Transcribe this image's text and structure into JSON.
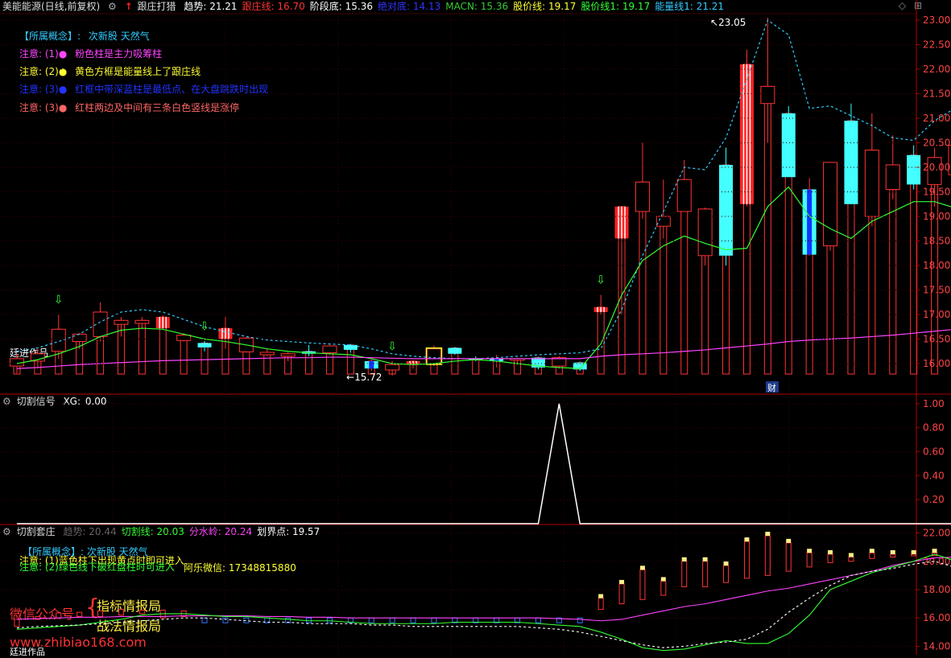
{
  "header": {
    "stock": "美能能源(日线,前复权)",
    "indicator": "跟庄打猎",
    "values": [
      {
        "label": "趋势:",
        "value": "21.21",
        "color": "#ffffff"
      },
      {
        "label": "跟庄线:",
        "value": "16.70",
        "color": "#ff3333"
      },
      {
        "label": "阶段底:",
        "value": "15.36",
        "color": "#ffffff"
      },
      {
        "label": "绝对底:",
        "value": "14.13",
        "color": "#3333ff"
      },
      {
        "label": "MACN:",
        "value": "15.36",
        "color": "#33cc33"
      },
      {
        "label": "股价线:",
        "value": "19.17",
        "color": "#ffff33"
      },
      {
        "label": "股价线1:",
        "value": "19.17",
        "color": "#33ff33"
      },
      {
        "label": "能量线1:",
        "value": "21.21",
        "color": "#33ccff"
      }
    ]
  },
  "notes": {
    "concept_label": "【所属概念】:",
    "concept_value": "次新股 天然气",
    "n1_label": "注意: (1)●",
    "n1_text": "粉色柱是主力吸筹柱",
    "n2_label": "注意: (2)●",
    "n2_text": "黄色方框是能量线上了跟庄线",
    "n3_label": "注意: (3)●",
    "n3_text": "红框中带深蓝柱是最低点、在大盘跳跌时出现",
    "n4_label": "注意: (3)●",
    "n4_text": "红柱两边及中间有三条白色竖线是涨停",
    "author": "廷进作品"
  },
  "panel2": {
    "title": "切割信号",
    "xg_label": "XG:",
    "xg_value": "0.00"
  },
  "panel3": {
    "title": "切割套庄",
    "values": [
      {
        "label": "趋势:",
        "value": "20.44",
        "color": "#666666"
      },
      {
        "label": "切割线:",
        "value": "20.03",
        "color": "#33ff33"
      },
      {
        "label": "分水岭:",
        "value": "20.24",
        "color": "#ff44ff"
      },
      {
        "label": "划界点:",
        "value": "19.57",
        "color": "#ffffff"
      }
    ],
    "concept": "【所属概念】: 次新股 天然气",
    "note1": "注意: (1)蓝色柱下出现黄点时即可进入",
    "note2": "注意: (2)绿色线下破红盘柱时可进入",
    "wechat": "阿乐微信: 17348815880",
    "promo1": "微信公众号",
    "promo2": "指标情报局",
    "promo3": "战法情报局",
    "url": "www.zhibiao168.com",
    "author": "廷进作品"
  },
  "annotations": {
    "high": "23.05",
    "low": "15.72",
    "fin": "财"
  },
  "chart_data": [
    {
      "type": "candlestick",
      "y_ticks": [
        "23.00",
        "22.50",
        "22.00",
        "21.50",
        "21.00",
        "20.50",
        "20.00",
        "19.50",
        "19.00",
        "18.50",
        "18.00",
        "17.50",
        "17.00",
        "16.50",
        "16.00"
      ],
      "ylim": [
        15.58,
        23.33
      ],
      "candles": [
        [
          15.95,
          16.2,
          15.8,
          16.1
        ],
        [
          16.05,
          16.3,
          15.9,
          16.2
        ],
        [
          16.25,
          17.0,
          16.1,
          16.7
        ],
        [
          16.45,
          16.62,
          16.3,
          16.6
        ],
        [
          16.55,
          17.25,
          16.45,
          17.05
        ],
        [
          16.8,
          16.95,
          16.55,
          16.88
        ],
        [
          16.88,
          16.95,
          16.7,
          16.82
        ],
        [
          16.95,
          16.98,
          16.7,
          16.72
        ],
        [
          16.58,
          16.62,
          16.45,
          16.47
        ],
        [
          16.42,
          16.46,
          16.25,
          16.33
        ],
        [
          16.5,
          16.95,
          16.3,
          16.72
        ],
        [
          16.52,
          16.54,
          16.22,
          16.24
        ],
        [
          16.23,
          16.29,
          16.15,
          16.18
        ],
        [
          16.2,
          16.23,
          16.05,
          16.15
        ],
        [
          16.2,
          16.38,
          16.15,
          16.25
        ],
        [
          16.36,
          16.38,
          16.18,
          16.22
        ],
        [
          16.38,
          16.4,
          16.22,
          16.28
        ],
        [
          16.05,
          16.1,
          15.85,
          15.9
        ],
        [
          15.87,
          16.05,
          15.76,
          15.98
        ],
        [
          15.98,
          16.07,
          15.9,
          16.05
        ],
        [
          16.0,
          16.37,
          15.95,
          16.3
        ],
        [
          16.32,
          16.34,
          16.18,
          16.2
        ],
        [
          16.1,
          16.15,
          16.05,
          16.1
        ],
        [
          16.1,
          16.18,
          15.92,
          16.05
        ],
        [
          16.1,
          16.12,
          15.98,
          16.08
        ],
        [
          16.12,
          16.14,
          15.88,
          15.92
        ],
        [
          15.95,
          16.15,
          15.9,
          16.12
        ],
        [
          16.02,
          16.04,
          15.85,
          15.88
        ],
        [
          17.15,
          17.4,
          17.0,
          17.05
        ],
        [
          18.55,
          19.2,
          17.0,
          19.2
        ],
        [
          19.1,
          20.5,
          18.95,
          19.7
        ],
        [
          18.8,
          19.75,
          18.55,
          19.0
        ],
        [
          19.75,
          20.15,
          19.1,
          19.1
        ],
        [
          19.15,
          19.18,
          18.0,
          18.2
        ],
        [
          18.2,
          20.4,
          18.0,
          20.05
        ],
        [
          19.25,
          22.4,
          19.2,
          22.1
        ],
        [
          21.3,
          23.05,
          20.5,
          21.65
        ],
        [
          21.1,
          21.25,
          19.85,
          19.8
        ],
        [
          19.55,
          19.78,
          18.2,
          18.22
        ],
        [
          18.4,
          20.1,
          18.3,
          20.1
        ],
        [
          20.95,
          21.3,
          19.25,
          19.25
        ],
        [
          19.0,
          21.1,
          18.8,
          20.35
        ],
        [
          19.55,
          20.65,
          19.35,
          20.05
        ],
        [
          20.25,
          20.45,
          19.55,
          19.65
        ],
        [
          19.65,
          20.4,
          19.2,
          20.2
        ],
        [
          19.85,
          20.6,
          16.9,
          20.45
        ]
      ],
      "candle_styles": {
        "hollow_red": [
          0,
          1,
          2,
          3,
          4,
          5,
          6,
          8,
          11,
          12,
          13,
          15,
          18,
          20,
          24,
          26,
          30,
          31,
          32,
          33,
          36,
          39,
          41,
          42,
          44,
          45
        ],
        "cyan": [
          9,
          14,
          16,
          21,
          22,
          25,
          27,
          34,
          37,
          40,
          43
        ],
        "blue_stripe": [
          17,
          23,
          38
        ],
        "red_white": [
          7,
          10,
          19,
          28,
          29,
          35
        ],
        "yellow_box": [
          20
        ]
      },
      "series": [
        {
          "name": "能量线1",
          "values": [
            16.25,
            16.32,
            16.45,
            16.6,
            16.85,
            17.05,
            17.1,
            17.05,
            16.9,
            16.75,
            16.65,
            16.55,
            16.48,
            16.45,
            16.42,
            16.4,
            16.38,
            16.3,
            16.2,
            16.15,
            16.12,
            16.1,
            16.1,
            16.12,
            16.15,
            16.18,
            16.2,
            16.22,
            16.3,
            17.1,
            18.2,
            19.1,
            20.0,
            19.95,
            20.6,
            21.8,
            23.0,
            22.7,
            21.2,
            21.25,
            21.05,
            20.85,
            20.6,
            20.55,
            20.95,
            21.21
          ]
        },
        {
          "name": "股价线1",
          "values": [
            16.0,
            16.08,
            16.2,
            16.35,
            16.55,
            16.68,
            16.72,
            16.7,
            16.6,
            16.5,
            16.45,
            16.38,
            16.3,
            16.25,
            16.22,
            16.2,
            16.18,
            16.1,
            16.0,
            15.98,
            16.0,
            16.05,
            16.08,
            16.05,
            16.0,
            15.95,
            15.92,
            15.9,
            16.4,
            17.4,
            18.1,
            18.4,
            18.6,
            18.45,
            18.32,
            18.35,
            19.2,
            19.6,
            19.0,
            18.75,
            18.55,
            18.9,
            19.1,
            19.3,
            19.3,
            19.17
          ]
        },
        {
          "name": "跟庄线",
          "values": [
            15.9,
            15.92,
            15.95,
            15.98,
            16.0,
            16.02,
            16.04,
            16.06,
            16.07,
            16.08,
            16.09,
            16.1,
            16.11,
            16.12,
            16.12,
            16.13,
            16.13,
            16.12,
            16.11,
            16.1,
            16.1,
            16.1,
            16.1,
            16.1,
            16.1,
            16.1,
            16.1,
            16.1,
            16.15,
            16.18,
            16.2,
            16.22,
            16.25,
            16.28,
            16.32,
            16.36,
            16.4,
            16.45,
            16.48,
            16.5,
            16.52,
            16.55,
            16.58,
            16.62,
            16.66,
            16.7
          ]
        }
      ]
    },
    {
      "type": "line",
      "y_ticks": [
        "1.00",
        "0.80",
        "0.60",
        "0.40",
        "0.20"
      ],
      "ylim": [
        0,
        1.08
      ],
      "series": [
        {
          "name": "XG",
          "values": [
            0,
            0,
            0,
            0,
            0,
            0,
            0,
            0,
            0,
            0,
            0,
            0,
            0,
            0,
            0,
            0,
            0,
            0,
            0,
            0,
            0,
            0,
            0,
            0,
            0,
            0,
            1,
            0,
            0,
            0,
            0,
            0,
            0,
            0,
            0,
            0,
            0,
            0,
            0,
            0,
            0,
            0,
            0,
            0,
            0,
            0
          ]
        }
      ]
    },
    {
      "type": "bar",
      "y_ticks": [
        "22.00",
        "20.00",
        "18.00",
        "16.00",
        "14.00"
      ],
      "ylim": [
        13.4,
        22.6
      ],
      "bars": [
        [
          15.4,
          15.9
        ],
        [
          15.9,
          16.1
        ],
        [
          16.0,
          16.35
        ],
        [
          16.1,
          16.4
        ],
        [
          16.1,
          16.5
        ],
        [
          16.2,
          16.6
        ],
        [
          16.3,
          16.55
        ],
        [
          16.0,
          16.55
        ],
        [
          16.1,
          16.5
        ],
        [
          15.8,
          16.15
        ],
        [
          16.0,
          16.4
        ],
        [
          15.7,
          16.05
        ],
        [
          15.6,
          16.0
        ],
        [
          15.6,
          15.95
        ],
        [
          15.7,
          16.05
        ],
        [
          15.8,
          16.0
        ],
        [
          15.75,
          16.0
        ],
        [
          15.7,
          16.0
        ],
        [
          15.5,
          15.8
        ],
        [
          15.6,
          15.9
        ],
        [
          15.7,
          16.0
        ],
        [
          15.7,
          16.0
        ],
        [
          15.8,
          16.0
        ],
        [
          15.8,
          16.1
        ],
        [
          15.8,
          16.0
        ],
        [
          15.9,
          16.1
        ],
        [
          16.0,
          16.3
        ],
        [
          16.2,
          16.5
        ],
        [
          16.6,
          17.4
        ],
        [
          17.0,
          18.4
        ],
        [
          17.3,
          19.4
        ],
        [
          17.6,
          18.6
        ],
        [
          18.2,
          20.0
        ],
        [
          18.2,
          20.0
        ],
        [
          18.5,
          19.7
        ],
        [
          18.8,
          21.4
        ],
        [
          19.0,
          21.8
        ],
        [
          19.3,
          21.3
        ],
        [
          19.6,
          20.6
        ],
        [
          19.9,
          20.5
        ],
        [
          20.0,
          20.3
        ],
        [
          20.2,
          20.6
        ],
        [
          20.3,
          20.5
        ],
        [
          20.4,
          20.5
        ],
        [
          20.4,
          20.6
        ],
        [
          20.5,
          20.7
        ]
      ],
      "series": [
        {
          "name": "分水岭",
          "values": [
            15.9,
            15.95,
            16.0,
            16.05,
            16.05,
            16.1,
            16.1,
            16.1,
            16.15,
            16.15,
            16.15,
            16.15,
            16.1,
            16.1,
            16.05,
            16.05,
            16.0,
            16.0,
            16.0,
            16.0,
            16.0,
            16.0,
            16.0,
            16.0,
            16.0,
            16.0,
            15.95,
            15.9,
            15.8,
            15.9,
            16.2,
            16.5,
            16.8,
            17.0,
            17.3,
            17.6,
            17.9,
            18.1,
            18.4,
            18.7,
            19.0,
            19.3,
            19.7,
            20.0,
            20.24,
            20.3
          ]
        },
        {
          "name": "切割线",
          "values": [
            15.2,
            15.3,
            15.4,
            15.5,
            15.7,
            15.9,
            16.2,
            16.3,
            16.3,
            16.2,
            16.1,
            16.1,
            16.0,
            15.9,
            15.8,
            15.8,
            15.7,
            15.6,
            15.6,
            15.6,
            15.6,
            15.7,
            15.7,
            15.7,
            15.7,
            15.6,
            15.5,
            15.4,
            15.0,
            14.5,
            13.9,
            13.7,
            13.8,
            14.1,
            14.4,
            14.2,
            14.2,
            14.9,
            16.2,
            18.0,
            18.6,
            19.2,
            19.6,
            20.0,
            20.5,
            20.03
          ]
        },
        {
          "name": "划界点",
          "values": [
            15.3,
            15.4,
            15.45,
            15.5,
            15.6,
            15.7,
            15.8,
            15.9,
            16.0,
            16.0,
            15.9,
            15.8,
            15.7,
            15.7,
            15.6,
            15.6,
            15.6,
            15.5,
            15.5,
            15.4,
            15.4,
            15.4,
            15.4,
            15.4,
            15.4,
            15.3,
            15.2,
            15.0,
            14.7,
            14.4,
            14.1,
            13.9,
            14.0,
            14.2,
            14.3,
            14.5,
            15.2,
            16.4,
            17.4,
            18.3,
            19.0,
            19.3,
            19.5,
            19.8,
            20.0,
            19.57
          ]
        }
      ]
    }
  ]
}
